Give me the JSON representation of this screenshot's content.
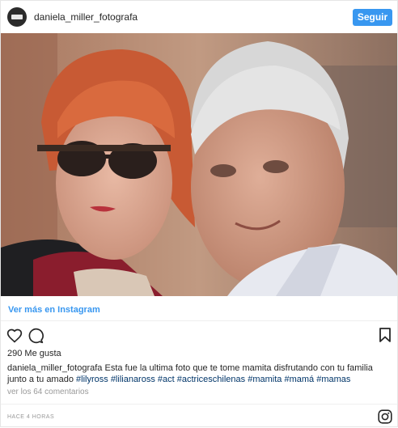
{
  "post": {
    "username": "daniela_miller_fotografa",
    "follow_label": "Seguir",
    "image_alt": "Pareja de adultos mayores",
    "view_more_label": "Ver más en Instagram",
    "likes": "290 Me gusta",
    "caption_user": "daniela_miller_fotografa",
    "caption_text": "Esta fue la ultima foto que te tome mamita disfrutando con tu familia junto a tu amado",
    "hashtags": [
      "#lilyross",
      "#lilianaross",
      "#act",
      "#actriceschilenas",
      "#mamita",
      "#mamá",
      "#mamas"
    ],
    "comments_label": "ver los 64 comentarios",
    "time_label": "HACE 4 HORAS"
  },
  "icons": {
    "like": "heart-icon",
    "comment": "comment-icon",
    "save": "bookmark-icon",
    "brand": "instagram-logo-icon"
  },
  "colors": {
    "accent": "#3897f0",
    "hashtag": "#003569",
    "muted": "#999999"
  }
}
